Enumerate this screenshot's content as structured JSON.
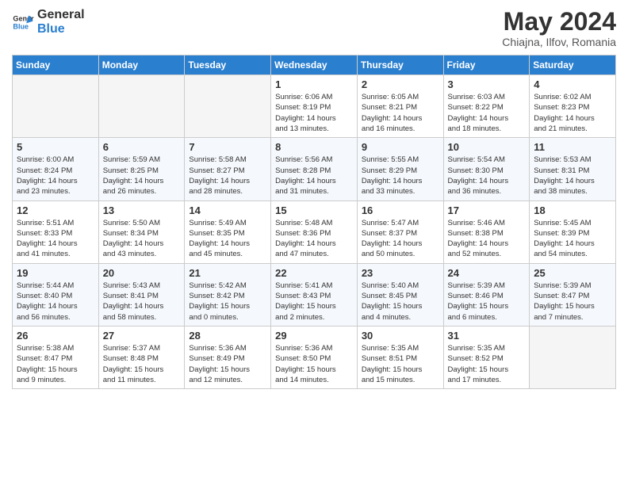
{
  "header": {
    "logo_general": "General",
    "logo_blue": "Blue",
    "month_title": "May 2024",
    "location": "Chiajna, Ilfov, Romania"
  },
  "days_of_week": [
    "Sunday",
    "Monday",
    "Tuesday",
    "Wednesday",
    "Thursday",
    "Friday",
    "Saturday"
  ],
  "weeks": [
    [
      {
        "day": "",
        "info": ""
      },
      {
        "day": "",
        "info": ""
      },
      {
        "day": "",
        "info": ""
      },
      {
        "day": "1",
        "info": "Sunrise: 6:06 AM\nSunset: 8:19 PM\nDaylight: 14 hours\nand 13 minutes."
      },
      {
        "day": "2",
        "info": "Sunrise: 6:05 AM\nSunset: 8:21 PM\nDaylight: 14 hours\nand 16 minutes."
      },
      {
        "day": "3",
        "info": "Sunrise: 6:03 AM\nSunset: 8:22 PM\nDaylight: 14 hours\nand 18 minutes."
      },
      {
        "day": "4",
        "info": "Sunrise: 6:02 AM\nSunset: 8:23 PM\nDaylight: 14 hours\nand 21 minutes."
      }
    ],
    [
      {
        "day": "5",
        "info": "Sunrise: 6:00 AM\nSunset: 8:24 PM\nDaylight: 14 hours\nand 23 minutes."
      },
      {
        "day": "6",
        "info": "Sunrise: 5:59 AM\nSunset: 8:25 PM\nDaylight: 14 hours\nand 26 minutes."
      },
      {
        "day": "7",
        "info": "Sunrise: 5:58 AM\nSunset: 8:27 PM\nDaylight: 14 hours\nand 28 minutes."
      },
      {
        "day": "8",
        "info": "Sunrise: 5:56 AM\nSunset: 8:28 PM\nDaylight: 14 hours\nand 31 minutes."
      },
      {
        "day": "9",
        "info": "Sunrise: 5:55 AM\nSunset: 8:29 PM\nDaylight: 14 hours\nand 33 minutes."
      },
      {
        "day": "10",
        "info": "Sunrise: 5:54 AM\nSunset: 8:30 PM\nDaylight: 14 hours\nand 36 minutes."
      },
      {
        "day": "11",
        "info": "Sunrise: 5:53 AM\nSunset: 8:31 PM\nDaylight: 14 hours\nand 38 minutes."
      }
    ],
    [
      {
        "day": "12",
        "info": "Sunrise: 5:51 AM\nSunset: 8:33 PM\nDaylight: 14 hours\nand 41 minutes."
      },
      {
        "day": "13",
        "info": "Sunrise: 5:50 AM\nSunset: 8:34 PM\nDaylight: 14 hours\nand 43 minutes."
      },
      {
        "day": "14",
        "info": "Sunrise: 5:49 AM\nSunset: 8:35 PM\nDaylight: 14 hours\nand 45 minutes."
      },
      {
        "day": "15",
        "info": "Sunrise: 5:48 AM\nSunset: 8:36 PM\nDaylight: 14 hours\nand 47 minutes."
      },
      {
        "day": "16",
        "info": "Sunrise: 5:47 AM\nSunset: 8:37 PM\nDaylight: 14 hours\nand 50 minutes."
      },
      {
        "day": "17",
        "info": "Sunrise: 5:46 AM\nSunset: 8:38 PM\nDaylight: 14 hours\nand 52 minutes."
      },
      {
        "day": "18",
        "info": "Sunrise: 5:45 AM\nSunset: 8:39 PM\nDaylight: 14 hours\nand 54 minutes."
      }
    ],
    [
      {
        "day": "19",
        "info": "Sunrise: 5:44 AM\nSunset: 8:40 PM\nDaylight: 14 hours\nand 56 minutes."
      },
      {
        "day": "20",
        "info": "Sunrise: 5:43 AM\nSunset: 8:41 PM\nDaylight: 14 hours\nand 58 minutes."
      },
      {
        "day": "21",
        "info": "Sunrise: 5:42 AM\nSunset: 8:42 PM\nDaylight: 15 hours\nand 0 minutes."
      },
      {
        "day": "22",
        "info": "Sunrise: 5:41 AM\nSunset: 8:43 PM\nDaylight: 15 hours\nand 2 minutes."
      },
      {
        "day": "23",
        "info": "Sunrise: 5:40 AM\nSunset: 8:45 PM\nDaylight: 15 hours\nand 4 minutes."
      },
      {
        "day": "24",
        "info": "Sunrise: 5:39 AM\nSunset: 8:46 PM\nDaylight: 15 hours\nand 6 minutes."
      },
      {
        "day": "25",
        "info": "Sunrise: 5:39 AM\nSunset: 8:47 PM\nDaylight: 15 hours\nand 7 minutes."
      }
    ],
    [
      {
        "day": "26",
        "info": "Sunrise: 5:38 AM\nSunset: 8:47 PM\nDaylight: 15 hours\nand 9 minutes."
      },
      {
        "day": "27",
        "info": "Sunrise: 5:37 AM\nSunset: 8:48 PM\nDaylight: 15 hours\nand 11 minutes."
      },
      {
        "day": "28",
        "info": "Sunrise: 5:36 AM\nSunset: 8:49 PM\nDaylight: 15 hours\nand 12 minutes."
      },
      {
        "day": "29",
        "info": "Sunrise: 5:36 AM\nSunset: 8:50 PM\nDaylight: 15 hours\nand 14 minutes."
      },
      {
        "day": "30",
        "info": "Sunrise: 5:35 AM\nSunset: 8:51 PM\nDaylight: 15 hours\nand 15 minutes."
      },
      {
        "day": "31",
        "info": "Sunrise: 5:35 AM\nSunset: 8:52 PM\nDaylight: 15 hours\nand 17 minutes."
      },
      {
        "day": "",
        "info": ""
      }
    ]
  ]
}
